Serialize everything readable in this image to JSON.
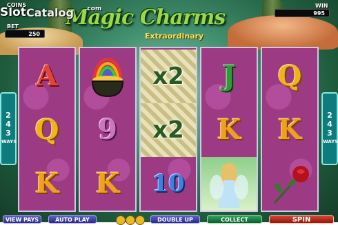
{
  "header": {
    "watermark": "Slot",
    "watermark_site": "Catalog",
    "watermark_com": ".com",
    "title": "Magic Charms",
    "subtitle": "Extraordinary"
  },
  "meters": {
    "coins_label": "COINS",
    "bet_label": "BET",
    "bet_value": "250",
    "win_label": "WIN",
    "win_value": "995"
  },
  "ways": {
    "line1": "2",
    "line2": "4",
    "line3": "3",
    "line4": "WAYS"
  },
  "reels": [
    [
      "A",
      "Q",
      "K"
    ],
    [
      "pot-of-gold",
      "9",
      "K"
    ],
    [
      "x2",
      "x2",
      "10"
    ],
    [
      "J",
      "K",
      "fairy"
    ],
    [
      "Q",
      "K",
      "rose"
    ]
  ],
  "symbol_text": {
    "a": "A",
    "q": "Q",
    "k": "K",
    "j": "J",
    "nine": "9",
    "ten": "10",
    "wild1": "x2",
    "wild2": "x2"
  },
  "buttons": {
    "view_pays": "VIEW PAYS",
    "auto_play": "AUTO PLAY",
    "double_up": "DOUBLE UP",
    "collect": "COLLECT",
    "spin": "SPIN"
  },
  "colors": {
    "reel_bg": "#9c3b84",
    "ways_bg": "#0e7c7c",
    "title": "#9ad84b",
    "subtitle": "#f8e15a"
  }
}
